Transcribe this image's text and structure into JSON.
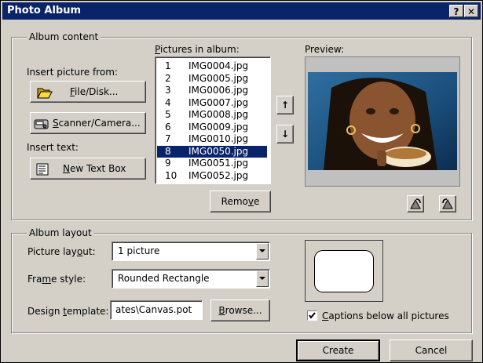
{
  "window": {
    "title": "Photo Album",
    "help_glyph": "?",
    "close_glyph": "✕"
  },
  "album_content": {
    "legend": "Album content",
    "insert_picture_label": "Insert picture from:",
    "file_disk_button": {
      "pre": "",
      "accel": "F",
      "post": "ile/Disk..."
    },
    "scanner_button": {
      "pre": "",
      "accel": "S",
      "post": "canner/Camera..."
    },
    "insert_text_label": "Insert text:",
    "new_text_box_button": {
      "pre": "",
      "accel": "N",
      "post": "ew Text Box"
    },
    "pictures_label": {
      "pre": "",
      "accel": "P",
      "post": "ictures in album:"
    },
    "pictures": [
      {
        "n": "1",
        "name": "IMG0004.jpg"
      },
      {
        "n": "2",
        "name": "IMG0005.jpg"
      },
      {
        "n": "3",
        "name": "IMG0006.jpg"
      },
      {
        "n": "4",
        "name": "IMG0007.jpg"
      },
      {
        "n": "5",
        "name": "IMG0008.jpg"
      },
      {
        "n": "6",
        "name": "IMG0009.jpg"
      },
      {
        "n": "7",
        "name": "IMG0010.jpg"
      },
      {
        "n": "8",
        "name": "IMG0050.jpg"
      },
      {
        "n": "9",
        "name": "IMG0051.jpg"
      },
      {
        "n": "10",
        "name": "IMG0052.jpg"
      }
    ],
    "selected_index": 7,
    "remove_button": {
      "pre": "Remo",
      "accel": "v",
      "post": "e"
    },
    "move_up_glyph": "↑",
    "move_down_glyph": "↓",
    "preview_label": "Preview:"
  },
  "album_layout": {
    "legend": "Album layout",
    "picture_layout_label": {
      "pre": "Picture lay",
      "accel": "o",
      "post": "ut:"
    },
    "picture_layout_value": "1 picture",
    "frame_style_label": {
      "pre": "Fra",
      "accel": "m",
      "post": "e style:"
    },
    "frame_style_value": "Rounded Rectangle",
    "design_template_label": {
      "pre": "Design ",
      "accel": "t",
      "post": "emplate:"
    },
    "design_template_value": "ates\\Canvas.pot",
    "browse_button": {
      "pre": "",
      "accel": "B",
      "post": "rowse..."
    },
    "captions_label": {
      "pre": "",
      "accel": "C",
      "post": "aptions below all pictures"
    },
    "captions_checked": true
  },
  "footer": {
    "create": "Create",
    "cancel": "Cancel"
  },
  "colors": {
    "title_bg": "#0a246a",
    "face": "#d4d0c8",
    "selection": "#0a246a"
  }
}
